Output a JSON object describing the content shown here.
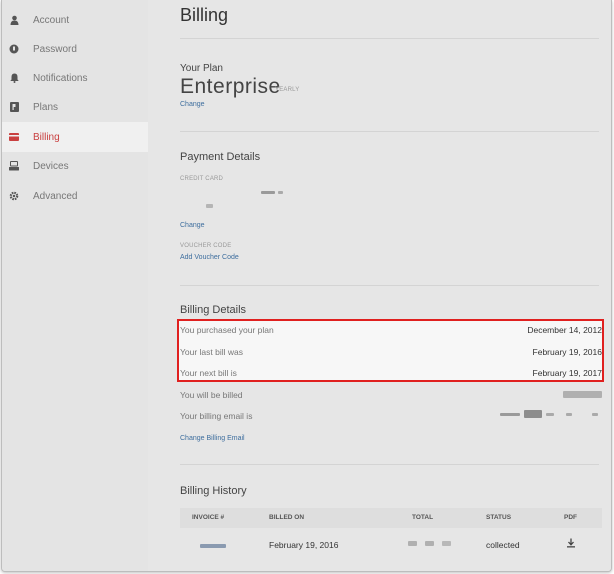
{
  "sidebar": {
    "items": [
      {
        "label": "Account",
        "icon": "user-icon"
      },
      {
        "label": "Password",
        "icon": "lock-icon"
      },
      {
        "label": "Notifications",
        "icon": "bell-icon"
      },
      {
        "label": "Plans",
        "icon": "plans-icon"
      },
      {
        "label": "Billing",
        "icon": "credit-card-icon",
        "active": true
      },
      {
        "label": "Devices",
        "icon": "devices-icon"
      },
      {
        "label": "Advanced",
        "icon": "gear-icon"
      }
    ]
  },
  "main": {
    "title": "Billing",
    "plan": {
      "heading": "Your Plan",
      "name": "Enterprise",
      "term": "YEARLY",
      "change_link": "Change"
    },
    "payment": {
      "heading": "Payment Details",
      "credit_card_label": "CREDIT CARD",
      "change_link": "Change",
      "voucher_label": "VOUCHER CODE",
      "add_voucher_link": "Add Voucher Code"
    },
    "billing_details": {
      "heading": "Billing Details",
      "rows": [
        {
          "label": "You purchased your plan",
          "value": "December 14, 2012"
        },
        {
          "label": "Your last bill was",
          "value": "February 19, 2016"
        },
        {
          "label": "Your next bill is",
          "value": "February 19, 2017"
        },
        {
          "label": "You will be billed",
          "value": ""
        },
        {
          "label": "Your billing email is",
          "value": ""
        }
      ],
      "change_email_link": "Change Billing Email"
    },
    "history": {
      "heading": "Billing History",
      "columns": [
        "INVOICE #",
        "BILLED ON",
        "TOTAL",
        "STATUS",
        "PDF"
      ],
      "rows": [
        {
          "billed_on": "February 19, 2016",
          "status": "collected"
        }
      ]
    }
  },
  "colors": {
    "accent": "#c94040",
    "highlight_border": "#e0201f",
    "link": "#3e6e9e"
  }
}
